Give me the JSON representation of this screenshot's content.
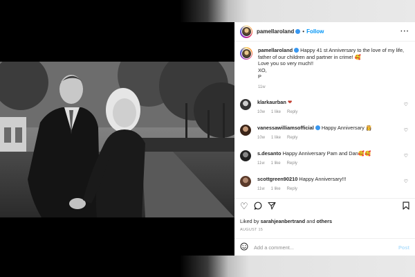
{
  "post": {
    "username": "pamellaroland",
    "separator": "•",
    "follow_label": "Follow",
    "more_label": "···",
    "caption": {
      "username": "pamellaroland",
      "line1": "Happy 41 st Anniversary to the love of my life,",
      "line2": "father of our children and partner in crime! 🥰",
      "line3": "Love you so very much!!",
      "line4": "XO,",
      "line5": "P",
      "age": "11w"
    },
    "comments": [
      {
        "username": "klarkaurban",
        "text": "❤",
        "age": "10w",
        "likes": "1 like",
        "reply": "Reply"
      },
      {
        "username": "vanessawilliamsofficial",
        "text": "Happy Anniversary 👸",
        "age": "10w",
        "likes": "1 like",
        "reply": "Reply"
      },
      {
        "username": "s.desanto",
        "text": "Happy Anniversary Pam and Dan🥰🥰",
        "age": "11w",
        "likes": "1 like",
        "reply": "Reply"
      },
      {
        "username": "scottgreen90210",
        "text": "Happy Anniversary!!!",
        "age": "11w",
        "likes": "1 like",
        "reply": "Reply"
      }
    ],
    "liked_by": {
      "prefix": "Liked by ",
      "user": "sarahjeanbertrand",
      "suffix": " and ",
      "others": "others"
    },
    "date": "AUGUST 15",
    "add_comment_placeholder": "Add a comment...",
    "post_label": "Post"
  },
  "icons": {
    "heart": "heart-icon",
    "comment": "comment-icon",
    "share": "share-icon",
    "save": "bookmark-icon",
    "emoji": "emoji-icon"
  },
  "colors": {
    "link_blue": "#0095f6",
    "post_disabled": "#b2dffc",
    "verified": "#3897f0"
  }
}
